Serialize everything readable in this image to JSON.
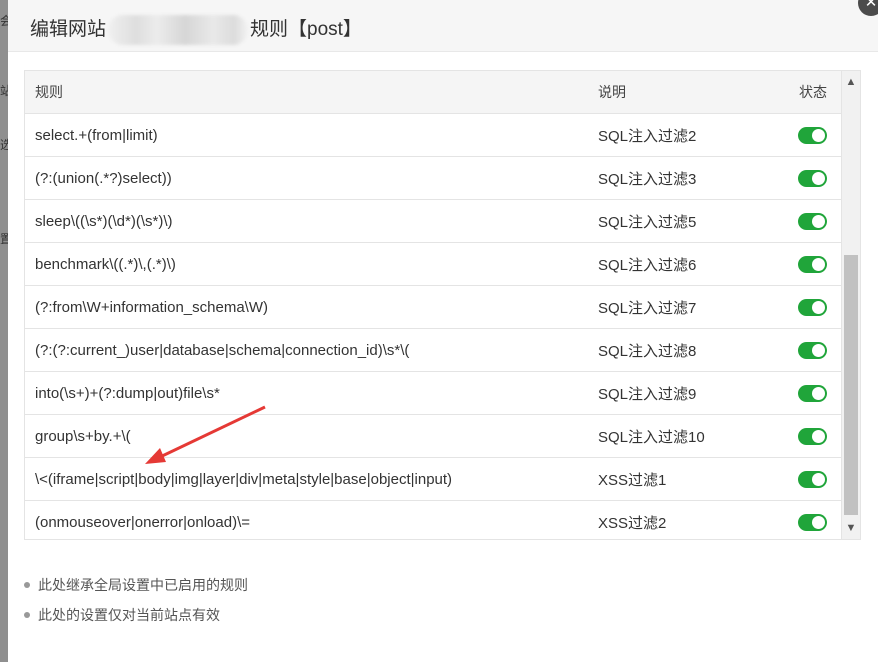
{
  "dialog": {
    "title_prefix": "编辑网站",
    "title_suffix": "规则【post】",
    "close_icon": "close-icon"
  },
  "table": {
    "headers": {
      "rule": "规则",
      "desc": "说明",
      "status": "状态"
    },
    "rows": [
      {
        "rule": "select.+(from|limit)",
        "desc": "SQL注入过滤2",
        "enabled": true
      },
      {
        "rule": "(?:(union(.*?)select))",
        "desc": "SQL注入过滤3",
        "enabled": true
      },
      {
        "rule": "sleep\\((\\s*)(\\d*)(\\s*)\\)",
        "desc": "SQL注入过滤5",
        "enabled": true
      },
      {
        "rule": "benchmark\\((.*)\\,(.*)\\)",
        "desc": "SQL注入过滤6",
        "enabled": true
      },
      {
        "rule": "(?:from\\W+information_schema\\W)",
        "desc": "SQL注入过滤7",
        "enabled": true
      },
      {
        "rule": "(?:(?:current_)user|database|schema|connection_id)\\s*\\(",
        "desc": "SQL注入过滤8",
        "enabled": true
      },
      {
        "rule": "into(\\s+)+(?:dump|out)file\\s*",
        "desc": "SQL注入过滤9",
        "enabled": true
      },
      {
        "rule": "group\\s+by.+\\(",
        "desc": "SQL注入过滤10",
        "enabled": true
      },
      {
        "rule": "\\<(iframe|script|body|img|layer|div|meta|style|base|object|input)",
        "desc": "XSS过滤1",
        "enabled": true
      },
      {
        "rule": "(onmouseover|onerror|onload)\\=",
        "desc": "XSS过滤2",
        "enabled": true
      }
    ]
  },
  "notes": [
    "此处继承全局设置中已启用的规则",
    "此处的设置仅对当前站点有效"
  ],
  "colors": {
    "toggle_on": "#20a53a",
    "annotation_arrow": "#e53935"
  },
  "backdrop_chars": [
    "会",
    "站",
    "选",
    "置"
  ]
}
